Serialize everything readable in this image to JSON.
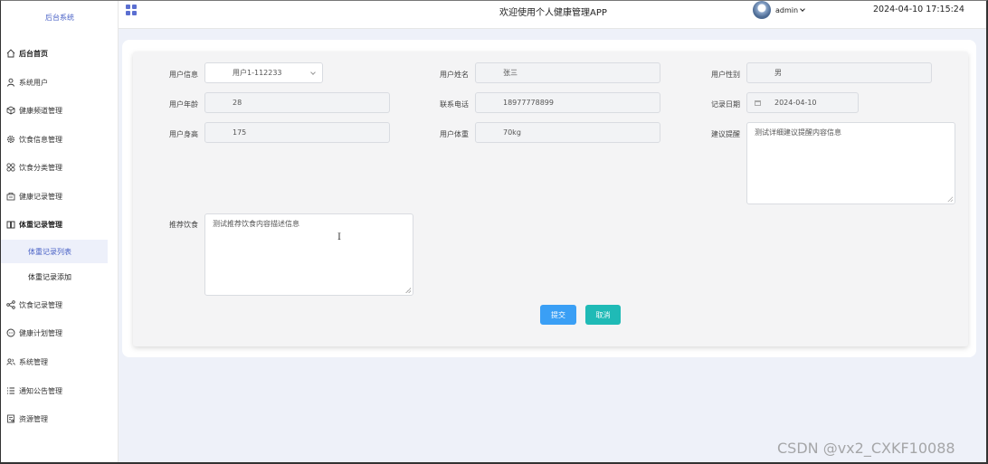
{
  "sidebar": {
    "title": "后台系统",
    "items": [
      {
        "label": "后台首页",
        "icon": "home-icon"
      },
      {
        "label": "系统用户",
        "icon": "user-icon"
      },
      {
        "label": "健康频道管理",
        "icon": "cube-icon"
      },
      {
        "label": "饮食信息管理",
        "icon": "gear-icon"
      },
      {
        "label": "饮食分类管理",
        "icon": "grid-icon"
      },
      {
        "label": "健康记录管理",
        "icon": "box-icon"
      },
      {
        "label": "体重记录管理",
        "icon": "book-icon"
      },
      {
        "label": "饮食记录管理",
        "icon": "share-icon"
      },
      {
        "label": "健康计划管理",
        "icon": "chat-icon"
      },
      {
        "label": "系统管理",
        "icon": "users-icon"
      },
      {
        "label": "通知公告管理",
        "icon": "list-icon"
      },
      {
        "label": "资源管理",
        "icon": "doc-icon"
      }
    ],
    "sub_items": [
      {
        "label": "体重记录列表"
      },
      {
        "label": "体重记录添加"
      }
    ]
  },
  "header": {
    "title": "欢迎使用个人健康管理APP",
    "user": "admin",
    "datetime": "2024-04-10 17:15:24"
  },
  "form": {
    "user_info_label": "用户信息",
    "user_info_value": "用户1-112233",
    "user_name_label": "用户姓名",
    "user_name_value": "张三",
    "gender_label": "用户性别",
    "gender_value": "男",
    "age_label": "用户年龄",
    "age_value": "28",
    "phone_label": "联系电话",
    "phone_value": "18977778899",
    "record_date_label": "记录日期",
    "record_date_value": "2024-04-10",
    "height_label": "用户身高",
    "height_value": "175",
    "weight_label": "用户体重",
    "weight_value": "70kg",
    "advice_label": "建议提醒",
    "advice_value": "测试详细建议提醒内容信息",
    "diet_label": "推荐饮食",
    "diet_value": "测试推荐饮食内容描述信息",
    "submit_label": "提交",
    "cancel_label": "取消"
  },
  "watermark": "CSDN @vx2_CXKF10088",
  "colors": {
    "accent": "#4a62c6",
    "submit": "#3a9ff5",
    "cancel": "#1fbab6",
    "background": "#eef1f9"
  }
}
